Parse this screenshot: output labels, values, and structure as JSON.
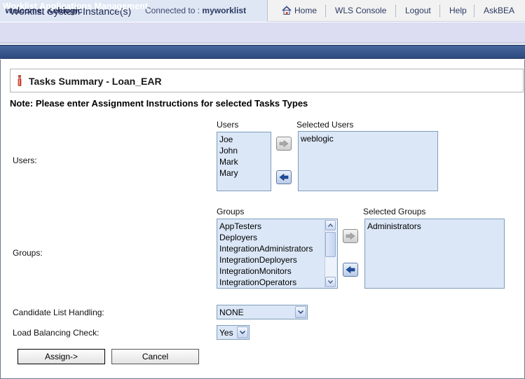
{
  "header": {
    "welcome": "Welcome, weblogic",
    "connected_label": "Connected to :",
    "connected_value": "myworklist",
    "nav": {
      "home": "Home",
      "wls_console": "WLS Console",
      "logout": "Logout",
      "help": "Help",
      "askbea": "AskBEA"
    }
  },
  "instance_bar": {
    "title": "Worklist System Instance(s)"
  },
  "section": {
    "title": "Worklist Applications Management"
  },
  "summary": {
    "title": "Tasks Summary - Loan_EAR"
  },
  "note": "Note: Please enter Assignment Instructions for selected Tasks Types",
  "users": {
    "row_label": "Users:",
    "available_label": "Users",
    "selected_label": "Selected Users",
    "available": [
      "Joe",
      "John",
      "Mark",
      "Mary"
    ],
    "selected": [
      "weblogic"
    ]
  },
  "groups": {
    "row_label": "Groups:",
    "available_label": "Groups",
    "selected_label": "Selected Groups",
    "available": [
      "AppTesters",
      "Deployers",
      "IntegrationAdministrators",
      "IntegrationDeployers",
      "IntegrationMonitors",
      "IntegrationOperators"
    ],
    "selected": [
      "Administrators"
    ]
  },
  "candidate": {
    "label": "Candidate List Handling:",
    "value": "NONE"
  },
  "load_balancing": {
    "label": "Load Balancing Check:",
    "value": "Yes"
  },
  "buttons": {
    "assign": "Assign->",
    "cancel": "Cancel"
  },
  "colors": {
    "section_header": "#2d4a80",
    "list_bg": "#dbe7f7",
    "instance_bar": "#dcdcf2"
  }
}
